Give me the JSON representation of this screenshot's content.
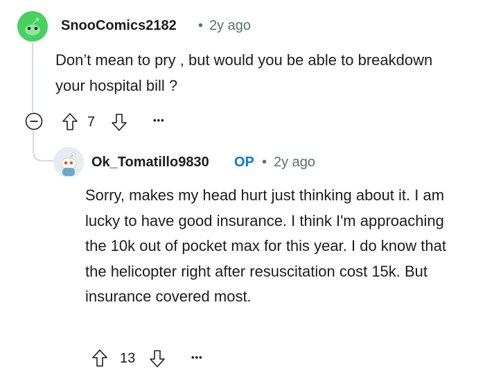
{
  "comment": {
    "username": "SnooComics2182",
    "separator": "•",
    "age": "2y ago",
    "body": "Don’t mean to pry , but would you be able to breakdown your hospital bill ?",
    "vote_count": "7",
    "more_label": "•••",
    "collapse_label": "−"
  },
  "reply": {
    "username": "Ok_Tomatillo9830",
    "op_badge": "OP",
    "separator": "•",
    "age": "2y ago",
    "body": "Sorry, makes my head hurt just thinking about it. I am lucky to have good insurance. I think I'm approaching the 10k out of pocket max for this year. I do know that the helicopter right after resuscitation cost 15k. But insurance covered most.",
    "vote_count": "13",
    "more_label": "•••"
  },
  "colors": {
    "avatar1_bg": "#46d160",
    "op_badge": "#0079d3",
    "meta_text": "#576f76",
    "thread_line": "#d7dadc"
  }
}
